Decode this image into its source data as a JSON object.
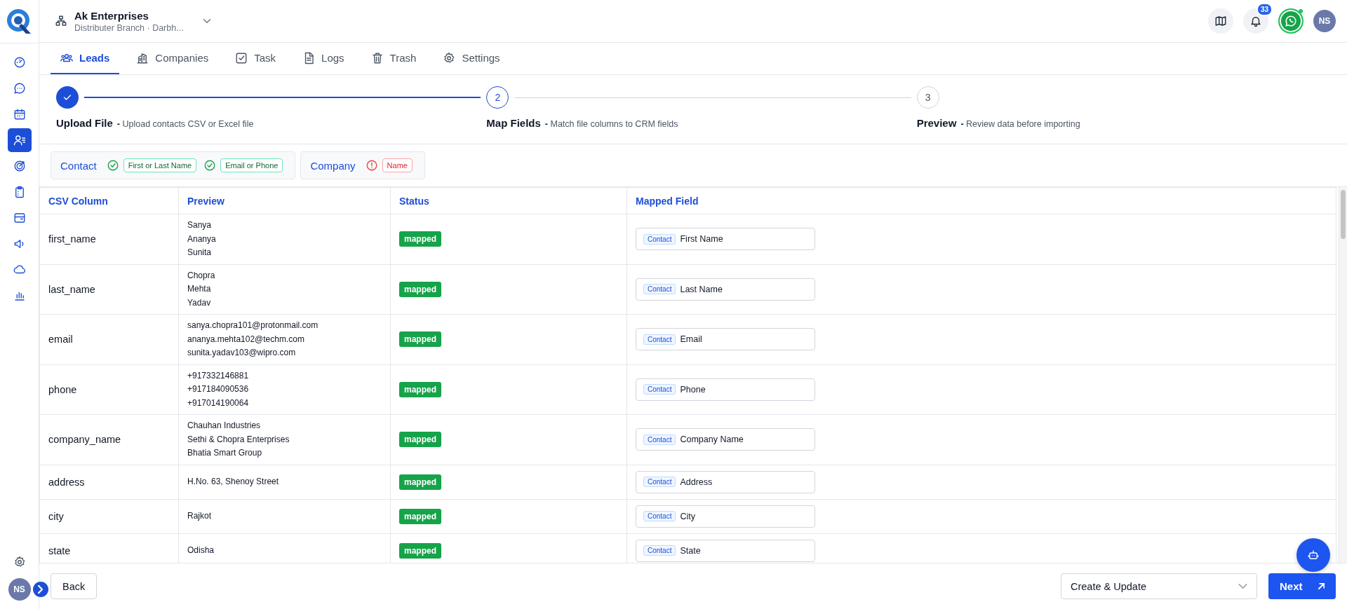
{
  "header": {
    "company": "Ak Enterprises",
    "branch": "Distributer Branch · Darbh...",
    "notifications": "33",
    "avatar": "NS"
  },
  "sidebar": {
    "items": [
      {
        "selected": false
      },
      {
        "selected": false
      },
      {
        "selected": false
      },
      {
        "selected": true
      },
      {
        "selected": false
      },
      {
        "selected": false
      },
      {
        "selected": false
      },
      {
        "selected": false
      },
      {
        "selected": false
      },
      {
        "selected": false
      }
    ],
    "avatar": "NS"
  },
  "tabs": [
    {
      "label": "Leads",
      "selected": true
    },
    {
      "label": "Companies",
      "selected": false
    },
    {
      "label": "Task",
      "selected": false
    },
    {
      "label": "Logs",
      "selected": false
    },
    {
      "label": "Trash",
      "selected": false
    },
    {
      "label": "Settings",
      "selected": false
    }
  ],
  "steps": [
    {
      "completed": true,
      "current": false,
      "title": "Upload File",
      "description": "**-** Upload contacts CSV or Excel file"
    },
    {
      "completed": false,
      "current": true,
      "number": "2",
      "title": "Map Fields",
      "description": "**-** Match file columns to CRM fields"
    },
    {
      "completed": false,
      "current": false,
      "number": "3",
      "title": "Preview",
      "description": "**-** Review data before importing"
    }
  ],
  "requirements": [
    {
      "entity": "Contact",
      "fields": [
        {
          "label": "First or Last Name",
          "met": true
        },
        {
          "label": "Email or Phone",
          "met": true
        }
      ]
    },
    {
      "entity": "Company",
      "fields": [
        {
          "label": "Name",
          "met": false
        }
      ]
    }
  ],
  "table": {
    "columns": [
      "CSV Column",
      "Preview",
      "Status",
      "Mapped Field"
    ],
    "rows": [
      {
        "column": "first_name",
        "preview": [
          "Sanya",
          "Ananya",
          "Sunita"
        ],
        "status": "mapped",
        "entity": "Contact",
        "field": "First Name"
      },
      {
        "column": "last_name",
        "preview": [
          "Chopra",
          "Mehta",
          "Yadav"
        ],
        "status": "mapped",
        "entity": "Contact",
        "field": "Last Name"
      },
      {
        "column": "email",
        "preview": [
          "sanya.chopra101@protonmail.com",
          "ananya.mehta102@techm.com",
          "sunita.yadav103@wipro.com"
        ],
        "status": "mapped",
        "entity": "Contact",
        "field": "Email"
      },
      {
        "column": "phone",
        "preview": [
          "+917332146881",
          "+917184090536",
          "+917014190064"
        ],
        "status": "mapped",
        "entity": "Contact",
        "field": "Phone"
      },
      {
        "column": "company_name",
        "preview": [
          "Chauhan Industries",
          "Sethi & Chopra Enterprises",
          "Bhatia Smart Group"
        ],
        "status": "mapped",
        "entity": "Contact",
        "field": "Company Name"
      },
      {
        "column": "address",
        "preview": [
          "H.No. 63, Shenoy Street"
        ],
        "status": "mapped",
        "entity": "Contact",
        "field": "Address"
      },
      {
        "column": "city",
        "preview": [
          "Rajkot"
        ],
        "status": "mapped",
        "entity": "Contact",
        "field": "City"
      },
      {
        "column": "state",
        "preview": [
          "Odisha"
        ],
        "status": "mapped",
        "entity": "Contact",
        "field": "State"
      }
    ]
  },
  "footer": {
    "back": "Back",
    "mode": "Create & Update",
    "next": "Next"
  }
}
